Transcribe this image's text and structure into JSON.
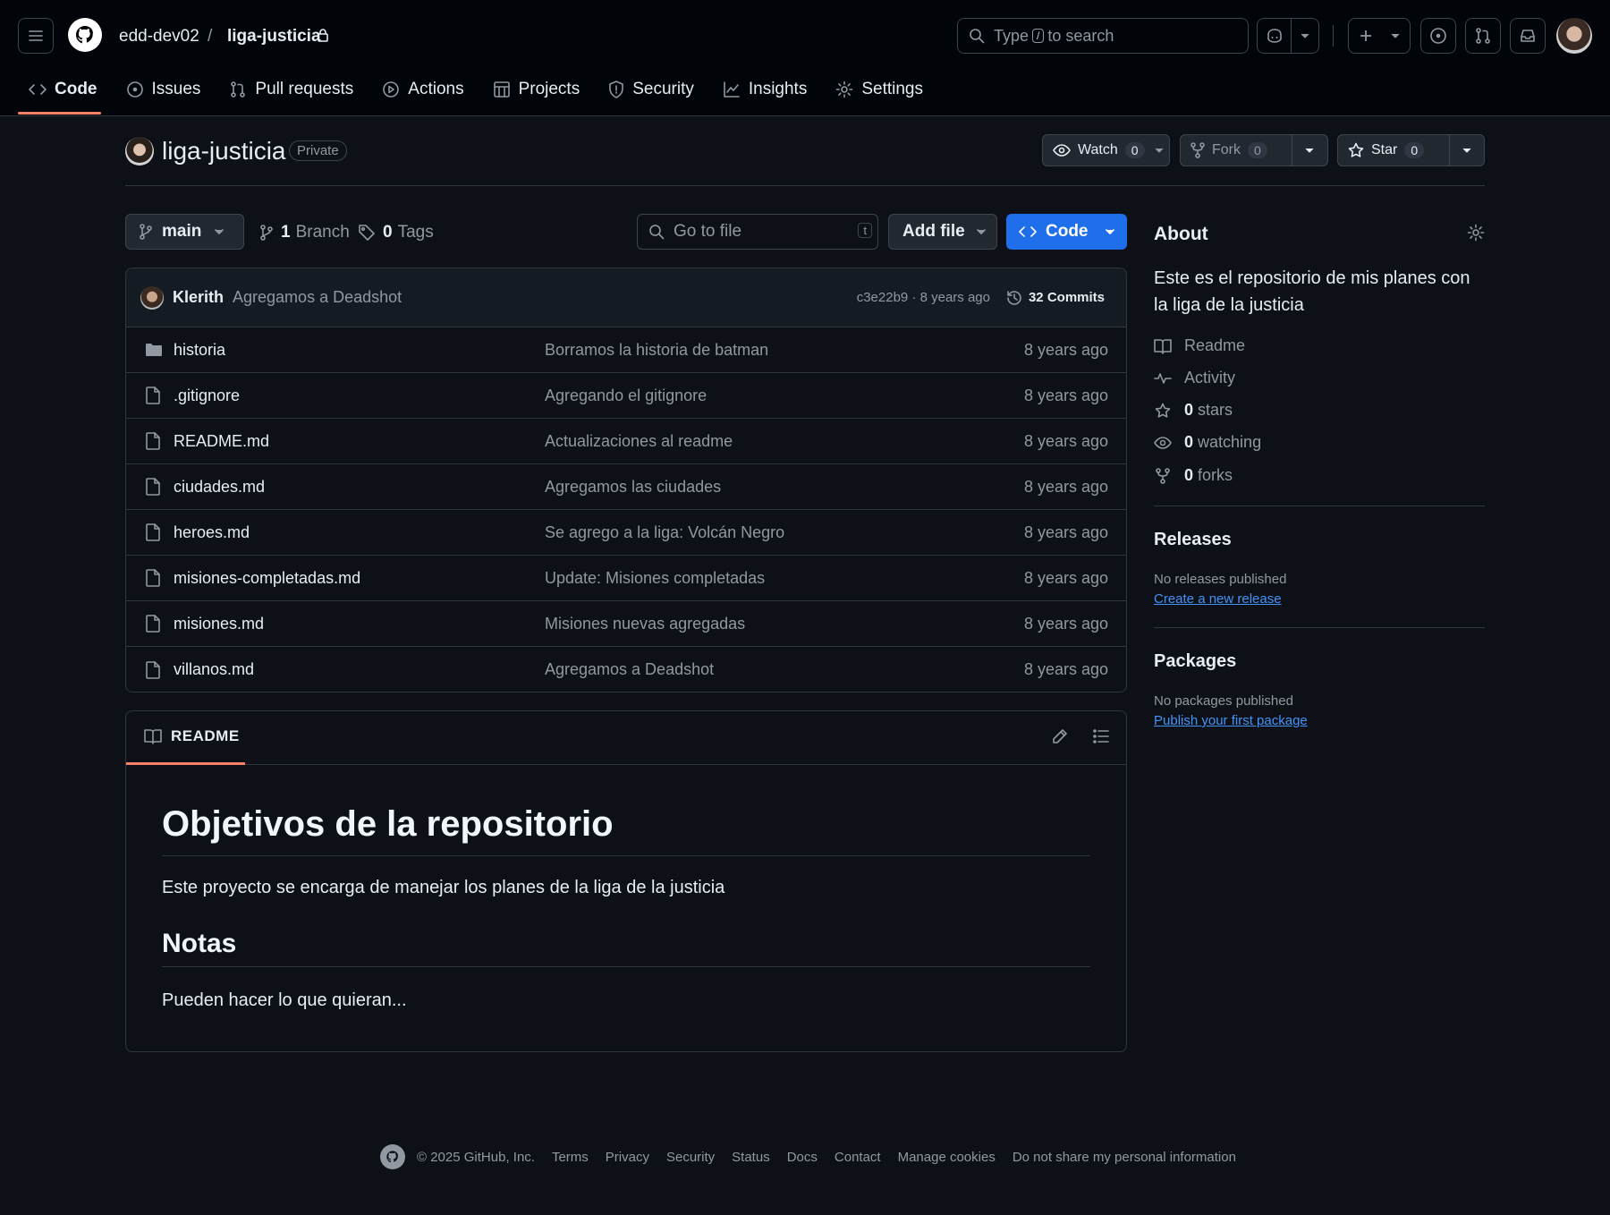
{
  "header": {
    "owner": "edd-dev02",
    "separator": "/",
    "repo": "liga-justicia",
    "search": {
      "prefix": "Type",
      "key": "/",
      "suffix": "to search"
    }
  },
  "nav": [
    {
      "label": "Code",
      "icon": "code-icon"
    },
    {
      "label": "Issues",
      "icon": "issue-icon"
    },
    {
      "label": "Pull requests",
      "icon": "pull-request-icon"
    },
    {
      "label": "Actions",
      "icon": "play-icon"
    },
    {
      "label": "Projects",
      "icon": "table-icon"
    },
    {
      "label": "Security",
      "icon": "shield-icon"
    },
    {
      "label": "Insights",
      "icon": "graph-icon"
    },
    {
      "label": "Settings",
      "icon": "gear-icon"
    }
  ],
  "repo": {
    "name": "liga-justicia",
    "visibility": "Private",
    "watch": {
      "label": "Watch",
      "count": "0"
    },
    "fork": {
      "label": "Fork",
      "count": "0"
    },
    "star": {
      "label": "Star",
      "count": "0"
    }
  },
  "toolbar": {
    "branch": "main",
    "branches_count": "1",
    "branches_label": "Branch",
    "tags_count": "0",
    "tags_label": "Tags",
    "goto_placeholder": "Go to file",
    "goto_key": "t",
    "add_file": "Add file",
    "code": "Code"
  },
  "latest_commit": {
    "author": "Klerith",
    "message": "Agregamos a Deadshot",
    "hash_time": "c3e22b9 · 8 years ago",
    "commits": "32 Commits"
  },
  "files": [
    {
      "type": "dir",
      "name": "historia",
      "message": "Borramos la historia de batman",
      "date": "8 years ago"
    },
    {
      "type": "file",
      "name": ".gitignore",
      "message": "Agregando el gitignore",
      "date": "8 years ago"
    },
    {
      "type": "file",
      "name": "README.md",
      "message": "Actualizaciones al readme",
      "date": "8 years ago"
    },
    {
      "type": "file",
      "name": "ciudades.md",
      "message": "Agregamos las ciudades",
      "date": "8 years ago"
    },
    {
      "type": "file",
      "name": "heroes.md",
      "message": "Se agrego a la liga: Volcán Negro",
      "date": "8 years ago"
    },
    {
      "type": "file",
      "name": "misiones-completadas.md",
      "message": "Update: Misiones completadas",
      "date": "8 years ago"
    },
    {
      "type": "file",
      "name": "misiones.md",
      "message": "Misiones nuevas agregadas",
      "date": "8 years ago"
    },
    {
      "type": "file",
      "name": "villanos.md",
      "message": "Agregamos a Deadshot",
      "date": "8 years ago"
    }
  ],
  "readme": {
    "tab": "README",
    "h1": "Objetivos de la repositorio",
    "p1": "Este proyecto se encarga de manejar los planes de la liga de la justicia",
    "h2": "Notas",
    "p2": "Pueden hacer lo que quieran..."
  },
  "about": {
    "title": "About",
    "description": "Este es el repositorio de mis planes con la liga de la justicia",
    "readme": "Readme",
    "activity": "Activity",
    "stars_count": "0",
    "stars_label": "stars",
    "watching_count": "0",
    "watching_label": "watching",
    "forks_count": "0",
    "forks_label": "forks"
  },
  "releases": {
    "title": "Releases",
    "note": "No releases published",
    "link": "Create a new release"
  },
  "packages": {
    "title": "Packages",
    "note": "No packages published",
    "link": "Publish your first package"
  },
  "footer": {
    "copyright": "© 2025 GitHub, Inc.",
    "links": [
      "Terms",
      "Privacy",
      "Security",
      "Status",
      "Docs",
      "Contact",
      "Manage cookies",
      "Do not share my personal information"
    ]
  },
  "colors": {
    "background": "#0d1117",
    "header": "#010409",
    "accent": "#1f6feb",
    "link": "#4493f8",
    "tab_underline": "#f78166"
  }
}
